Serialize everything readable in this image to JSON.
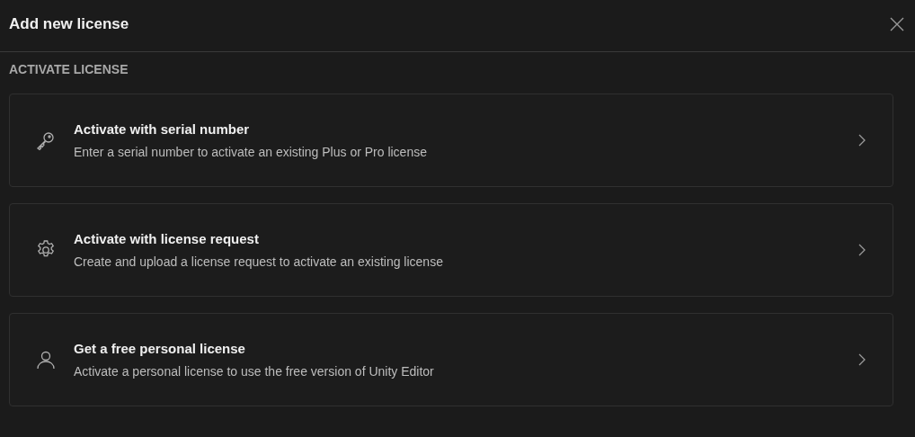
{
  "dialog": {
    "title": "Add new license"
  },
  "section": {
    "heading": "ACTIVATE LICENSE"
  },
  "options": [
    {
      "kind": "key",
      "title": "Activate with serial number",
      "description": "Enter a serial number to activate an existing Plus or Pro license"
    },
    {
      "kind": "gear",
      "title": "Activate with license request",
      "description": "Create and upload a license request to activate an existing license"
    },
    {
      "kind": "person",
      "title": "Get a free personal license",
      "description": "Activate a personal license to use the free version of Unity Editor"
    }
  ]
}
